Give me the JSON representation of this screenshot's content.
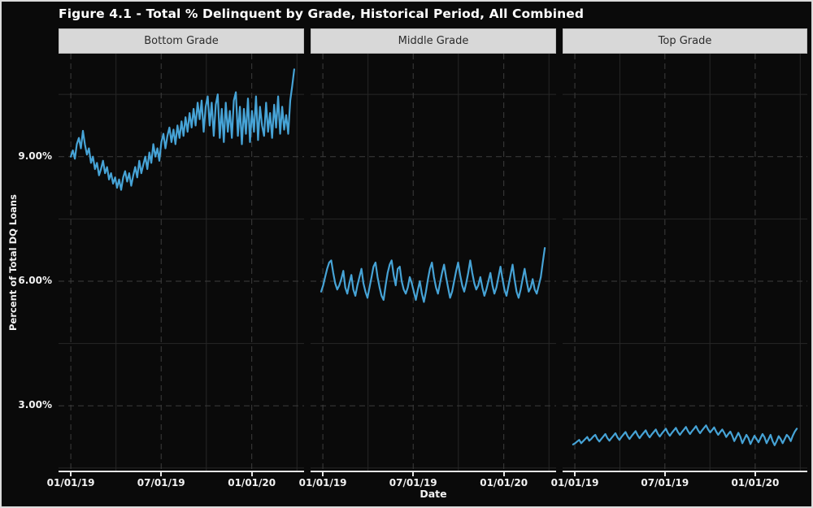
{
  "colors": {
    "background": "#0a0a0a",
    "figure_border": "#dcdcdc",
    "line": "#46a3d6",
    "major_grid": "#3d3d3d",
    "minor_grid": "#272727",
    "strip_background": "#d8d8d8",
    "strip_text": "#2b2b2b",
    "axis_line": "#e6e6e6",
    "text": "#f2f2f2"
  },
  "chart_data": {
    "type": "line",
    "title": "Figure 4.1 - Total % Delinquent by Grade, Historical Period, All Combined",
    "xlabel": "Date",
    "ylabel": "Percent of Total DQ Loans",
    "legend": "none",
    "grid": "major dashed, minor solid",
    "ylim": [
      1.42,
      11.48
    ],
    "y_major_ticks": [
      {
        "value": 9,
        "label": "9.00%"
      },
      {
        "value": 6,
        "label": "6.00%"
      },
      {
        "value": 3,
        "label": "3.00%"
      }
    ],
    "y_minor_values": [
      10.5,
      7.5,
      4.5,
      1.5
    ],
    "x_major_ticks": [
      {
        "frac": 0.05,
        "label": "01/01/19"
      },
      {
        "frac": 0.418,
        "label": "07/01/19"
      },
      {
        "frac": 0.787,
        "label": "01/01/20"
      }
    ],
    "x_minor_fracs": [
      0.234,
      0.602,
      0.971
    ],
    "panels": [
      {
        "label": "Bottom Grade",
        "x_start_frac": 0.05,
        "x_end_frac": 0.96,
        "values": [
          9.0,
          9.15,
          8.95,
          9.3,
          9.45,
          9.2,
          9.62,
          9.3,
          9.05,
          9.2,
          8.85,
          9.0,
          8.7,
          8.85,
          8.55,
          8.7,
          8.9,
          8.6,
          8.75,
          8.45,
          8.6,
          8.35,
          8.5,
          8.25,
          8.45,
          8.2,
          8.5,
          8.65,
          8.4,
          8.6,
          8.3,
          8.55,
          8.75,
          8.5,
          8.9,
          8.6,
          8.8,
          9.0,
          8.7,
          9.1,
          8.85,
          9.3,
          9.0,
          9.2,
          8.9,
          9.35,
          9.55,
          9.2,
          9.5,
          9.7,
          9.35,
          9.65,
          9.3,
          9.75,
          9.45,
          9.85,
          9.5,
          9.95,
          9.6,
          10.05,
          9.7,
          10.15,
          9.75,
          10.3,
          9.9,
          10.35,
          9.6,
          10.2,
          10.45,
          9.75,
          10.3,
          9.5,
          10.25,
          10.5,
          9.45,
          10.15,
          9.35,
          10.3,
          9.6,
          10.1,
          9.45,
          10.35,
          10.55,
          9.5,
          10.2,
          9.3,
          10.15,
          9.55,
          10.4,
          9.35,
          10.1,
          9.6,
          10.45,
          9.4,
          10.2,
          9.75,
          9.5,
          10.3,
          9.6,
          10.05,
          9.45,
          10.25,
          9.7,
          10.45,
          9.55,
          10.2,
          9.65,
          10.0,
          9.55,
          10.35,
          10.7,
          11.1
        ]
      },
      {
        "label": "Middle Grade",
        "x_start_frac": 0.043,
        "x_end_frac": 0.954,
        "values": [
          5.75,
          5.9,
          6.1,
          6.3,
          6.45,
          6.5,
          6.2,
          5.95,
          5.8,
          5.9,
          6.05,
          6.25,
          5.85,
          5.7,
          5.95,
          6.15,
          5.8,
          5.65,
          5.9,
          6.1,
          6.3,
          5.95,
          5.75,
          5.6,
          5.85,
          6.1,
          6.35,
          6.45,
          6.1,
          5.85,
          5.65,
          5.55,
          5.9,
          6.2,
          6.4,
          6.5,
          6.15,
          5.9,
          6.3,
          6.35,
          6.0,
          5.8,
          5.7,
          5.85,
          6.1,
          5.95,
          5.75,
          5.55,
          5.8,
          6.0,
          5.7,
          5.5,
          5.75,
          6.05,
          6.3,
          6.45,
          6.1,
          5.85,
          5.7,
          5.95,
          6.2,
          6.4,
          6.1,
          5.85,
          5.6,
          5.75,
          6.0,
          6.25,
          6.45,
          6.15,
          5.9,
          5.75,
          5.95,
          6.2,
          6.5,
          6.2,
          5.95,
          5.8,
          5.9,
          6.1,
          5.85,
          5.65,
          5.8,
          6.0,
          6.2,
          5.9,
          5.7,
          5.85,
          6.1,
          6.35,
          6.05,
          5.8,
          5.65,
          5.9,
          6.15,
          6.4,
          6.05,
          5.75,
          5.6,
          5.8,
          6.05,
          6.3,
          6.0,
          5.75,
          5.85,
          6.05,
          5.8,
          5.7,
          5.9,
          6.1,
          6.45,
          6.8
        ]
      },
      {
        "label": "Top Grade",
        "x_start_frac": 0.043,
        "x_end_frac": 0.957,
        "values": [
          2.07,
          2.1,
          2.14,
          2.18,
          2.1,
          2.15,
          2.2,
          2.25,
          2.16,
          2.2,
          2.26,
          2.3,
          2.2,
          2.14,
          2.2,
          2.26,
          2.32,
          2.22,
          2.16,
          2.22,
          2.28,
          2.34,
          2.24,
          2.18,
          2.25,
          2.31,
          2.37,
          2.27,
          2.2,
          2.27,
          2.33,
          2.39,
          2.29,
          2.22,
          2.29,
          2.35,
          2.41,
          2.31,
          2.24,
          2.31,
          2.37,
          2.43,
          2.33,
          2.26,
          2.33,
          2.39,
          2.45,
          2.35,
          2.28,
          2.35,
          2.41,
          2.47,
          2.37,
          2.3,
          2.37,
          2.43,
          2.49,
          2.39,
          2.32,
          2.39,
          2.45,
          2.51,
          2.41,
          2.34,
          2.41,
          2.47,
          2.53,
          2.43,
          2.36,
          2.42,
          2.48,
          2.38,
          2.3,
          2.37,
          2.43,
          2.35,
          2.25,
          2.32,
          2.38,
          2.28,
          2.15,
          2.25,
          2.35,
          2.25,
          2.1,
          2.2,
          2.3,
          2.22,
          2.08,
          2.18,
          2.28,
          2.2,
          2.12,
          2.22,
          2.32,
          2.24,
          2.1,
          2.2,
          2.3,
          2.15,
          2.05,
          2.15,
          2.27,
          2.2,
          2.1,
          2.2,
          2.3,
          2.25,
          2.15,
          2.28,
          2.38,
          2.45
        ]
      }
    ]
  }
}
